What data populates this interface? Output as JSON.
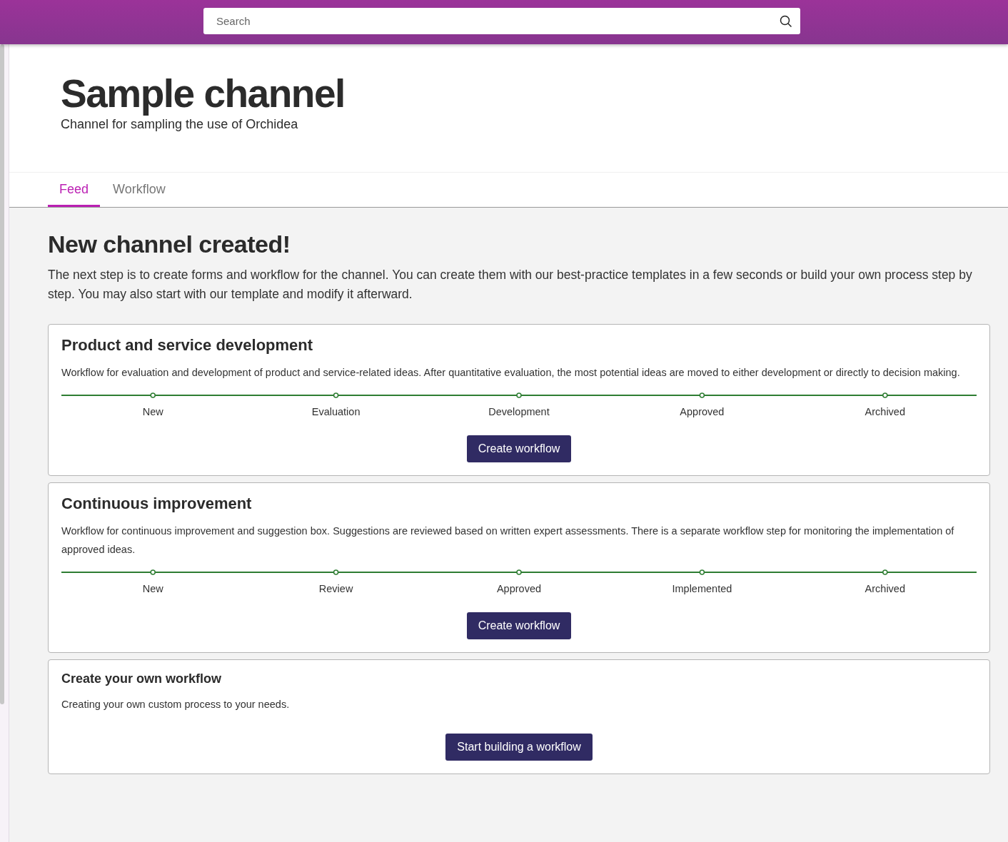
{
  "search": {
    "placeholder": "Search"
  },
  "channel": {
    "title": "Sample channel",
    "subtitle": "Channel for sampling the use of Orchidea"
  },
  "tabs": [
    {
      "label": "Feed",
      "selected": true
    },
    {
      "label": "Workflow",
      "selected": false
    }
  ],
  "intro": {
    "heading": "New channel created!",
    "text": "The next step is to create forms and workflow for the channel. You can create them with our best-practice templates in a few seconds or build your own process step by step. You may also start with our template and modify it afterward."
  },
  "templates": [
    {
      "kind": "template",
      "title": "Product and service development",
      "description": "Workflow for evaluation and development of product and service-related ideas. After quantitative evaluation, the most potential ideas are moved to either development or directly to decision making.",
      "steps": [
        "New",
        "Evaluation",
        "Development",
        "Approved",
        "Archived"
      ],
      "button": "Create workflow"
    },
    {
      "kind": "template",
      "title": "Continuous improvement",
      "description": "Workflow for continuous improvement and suggestion box. Suggestions are reviewed based on written expert assessments. There is a separate workflow step for monitoring the implementation of approved ideas.",
      "steps": [
        "New",
        "Review",
        "Approved",
        "Implemented",
        "Archived"
      ],
      "button": "Create workflow"
    },
    {
      "kind": "custom",
      "title": "Create your own workflow",
      "description": "Creating your own custom process to your needs.",
      "button": "Start building a workflow"
    }
  ]
}
